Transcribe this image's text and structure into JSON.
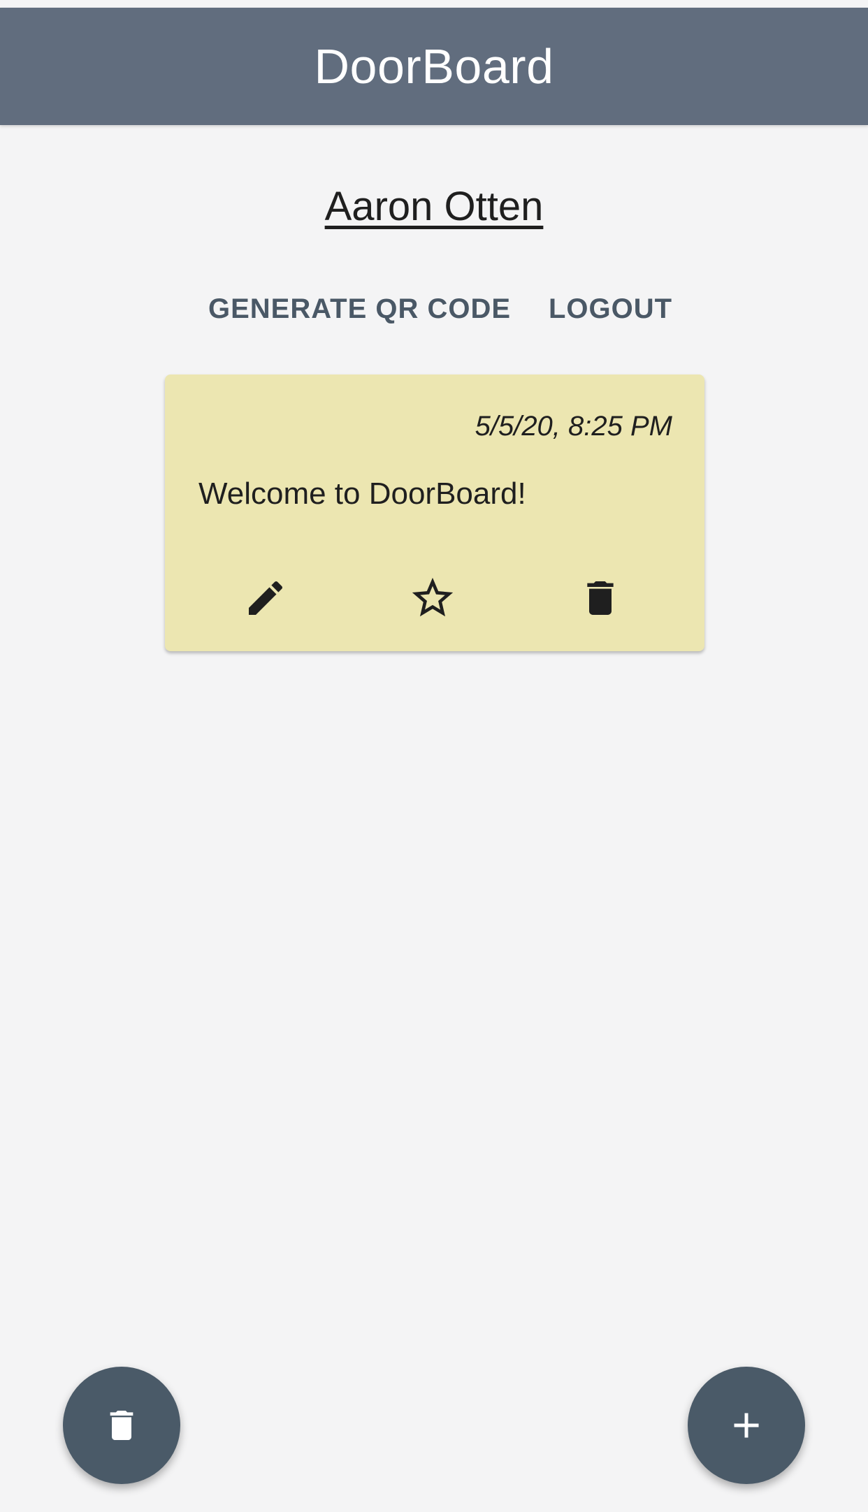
{
  "app": {
    "title": "DoorBoard",
    "colors": {
      "header": "#616d7e",
      "note": "#ece6b1",
      "fab": "#4a5a68",
      "background": "#f4f4f5"
    }
  },
  "profile": {
    "name": "Aaron Otten"
  },
  "actions": {
    "generate_qr": "GENERATE QR CODE",
    "logout": "LOGOUT"
  },
  "notes": [
    {
      "date": "5/5/20, 8:25 PM",
      "text": "Welcome to DoorBoard!",
      "icons": [
        "edit-icon",
        "star-outline-icon",
        "delete-icon"
      ]
    }
  ],
  "fabs": {
    "left_icon": "delete-icon",
    "right_icon": "add-icon"
  }
}
